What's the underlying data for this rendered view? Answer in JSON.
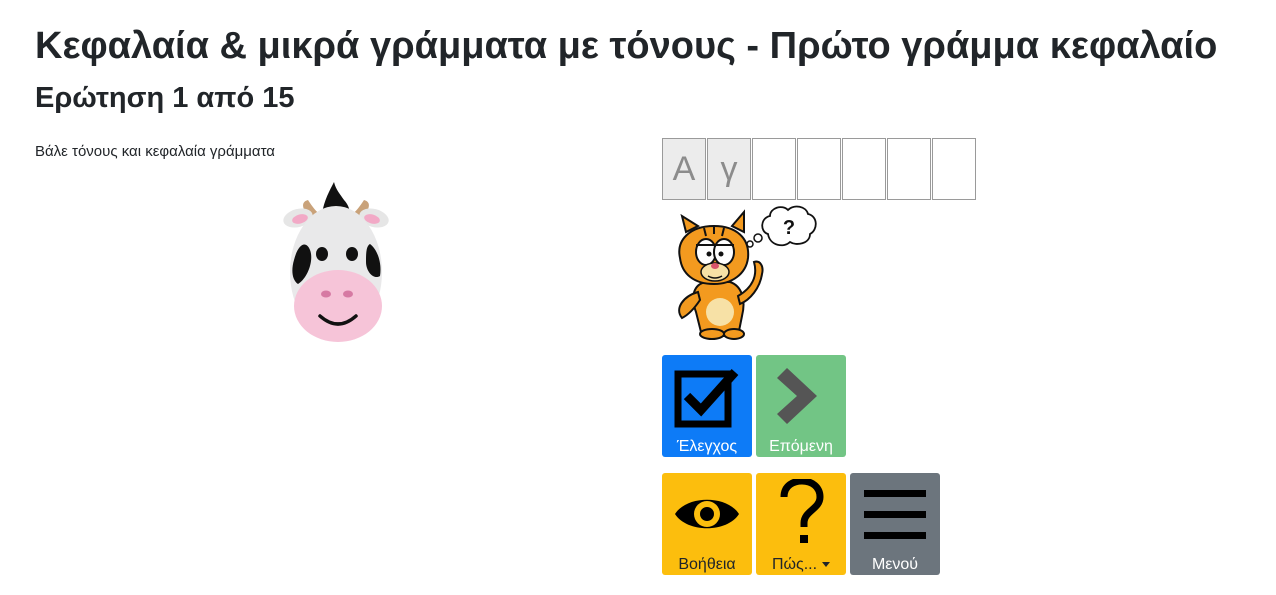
{
  "page": {
    "title": "Κεφαλαία & μικρά γράμματα με τόνους - Πρώτο γράμμα κεφαλαίο",
    "subtitle": "Ερώτηση 1 από 15",
    "instruction": "Βάλε τόνους και κεφαλαία γράμματα"
  },
  "answer": {
    "cells": [
      "Α",
      "γ",
      "",
      "",
      "",
      "",
      ""
    ]
  },
  "thought_bubble": {
    "text": "?"
  },
  "buttons": {
    "check": "Έλεγχος",
    "next": "Επόμενη",
    "help": "Βοήθεια",
    "how": "Πώς...",
    "menu": "Μενού"
  },
  "colors": {
    "check": "#0d7bf7",
    "next": "#72c585",
    "help": "#fcbe0d",
    "menu": "#6c757d"
  }
}
